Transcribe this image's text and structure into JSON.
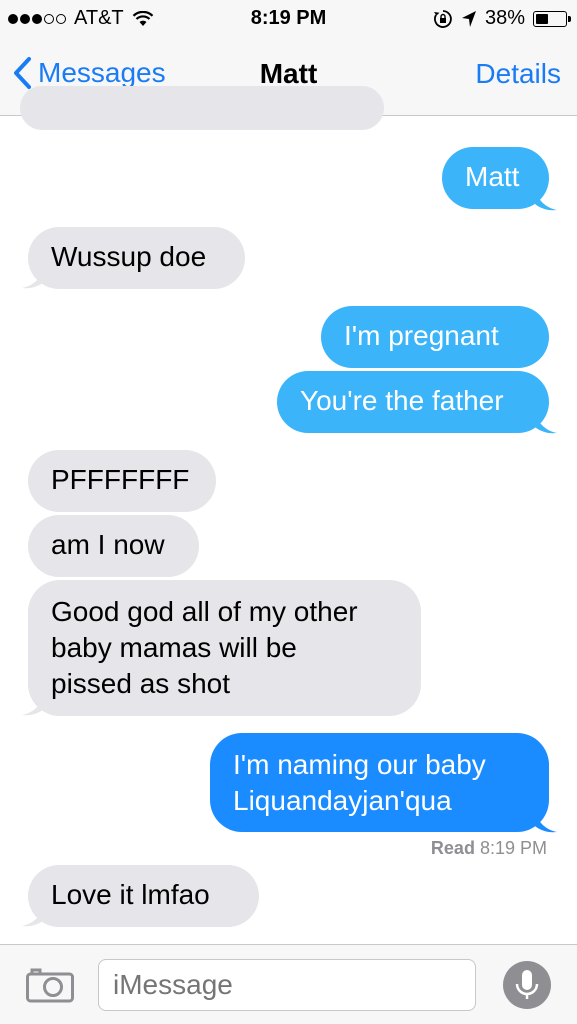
{
  "status_bar": {
    "carrier": "AT&T",
    "time": "8:19 PM",
    "battery": "38%",
    "battery_level": 0.38
  },
  "nav": {
    "back_label": "Messages",
    "title": "Matt",
    "details_label": "Details"
  },
  "messages": [
    {
      "text": "Matt",
      "direction": "sent"
    },
    {
      "text": "Wussup doe",
      "direction": "received"
    },
    {
      "text": "I'm pregnant",
      "direction": "sent"
    },
    {
      "text": "You're the father",
      "direction": "sent"
    },
    {
      "text": "PFFFFFFF",
      "direction": "received"
    },
    {
      "text": "am I now",
      "direction": "received"
    },
    {
      "lines": [
        "Good god all of my other",
        "baby mamas will be",
        "pissed as shot"
      ],
      "direction": "received"
    },
    {
      "lines": [
        "I'm naming our baby",
        "Liquandayjan'qua"
      ],
      "direction": "sent"
    },
    {
      "text": "Love it lmfao",
      "direction": "received"
    }
  ],
  "read_receipt": {
    "label": "Read",
    "time": "8:19 PM"
  },
  "input": {
    "placeholder": "iMessage"
  },
  "colors": {
    "ios_blue": "#1a7cf4",
    "sent_bubble": "#1a8cff",
    "received_bubble": "#e5e5ea"
  }
}
